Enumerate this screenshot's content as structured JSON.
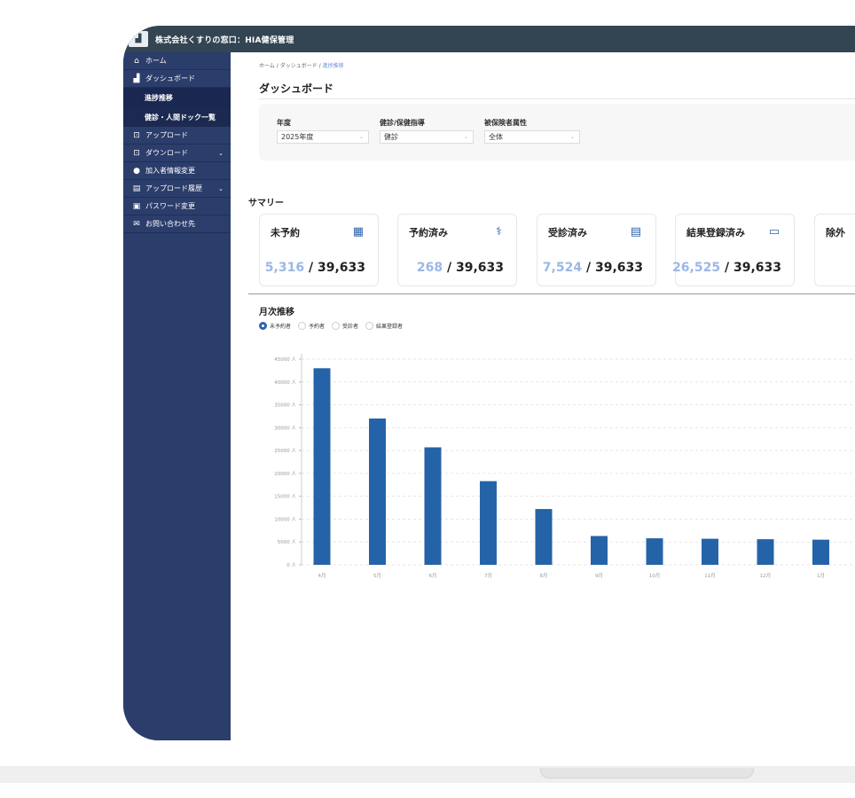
{
  "app": {
    "title": "株式会社くすりの窓口：HIA健保管理",
    "logo_icon": "building-logo-icon"
  },
  "sidebar": {
    "items": [
      {
        "label": "ホーム",
        "icon": "home-icon"
      },
      {
        "label": "ダッシュボード",
        "icon": "chart-icon",
        "sub": [
          "進捗推移",
          "健診・人間ドック一覧"
        ]
      },
      {
        "label": "アップロード",
        "icon": "upload-icon"
      },
      {
        "label": "ダウンロード",
        "icon": "download-icon",
        "chevron": true
      },
      {
        "label": "加入者情報変更",
        "icon": "user-icon"
      },
      {
        "label": "アップロード履歴",
        "icon": "history-icon",
        "chevron": true
      },
      {
        "label": "パスワード変更",
        "icon": "lock-icon"
      },
      {
        "label": "お問い合わせ先",
        "icon": "mail-icon"
      }
    ]
  },
  "breadcrumb": {
    "home": "ホーム",
    "sep": "/",
    "dashboard": "ダッシュボード",
    "current": "進捗推移"
  },
  "page_title": "ダッシュボード",
  "filters": {
    "year": {
      "label": "年度",
      "value": "2025年度"
    },
    "type": {
      "label": "健診/保健指導",
      "value": "健診"
    },
    "attr": {
      "label": "被保険者属性",
      "value": "全体"
    }
  },
  "summary": {
    "title": "サマリー",
    "total": "39,633",
    "cards": [
      {
        "label": "未予約",
        "value": "5,316",
        "icon": "calendar-icon"
      },
      {
        "label": "予約済み",
        "value": "268",
        "icon": "stethoscope-icon"
      },
      {
        "label": "受診済み",
        "value": "7,524",
        "icon": "clipboard-icon"
      },
      {
        "label": "結果登録済み",
        "value": "26,525",
        "icon": "message-icon"
      },
      {
        "label": "除外",
        "value": "",
        "icon": ""
      }
    ]
  },
  "monthly": {
    "title": "月次推移",
    "radios": [
      {
        "label": "未予約者",
        "checked": true
      },
      {
        "label": "予約者",
        "checked": false
      },
      {
        "label": "受診者",
        "checked": false
      },
      {
        "label": "結果登録者",
        "checked": false
      }
    ]
  },
  "colors": {
    "bar": "#2563a8",
    "accent": "#2e63ad"
  },
  "chart_data": {
    "type": "bar",
    "categories": [
      "4月",
      "5月",
      "6月",
      "7月",
      "8月",
      "9月",
      "10月",
      "11月",
      "12月",
      "1月"
    ],
    "values": [
      43000,
      32000,
      25700,
      18300,
      12200,
      6300,
      5800,
      5700,
      5600,
      5500
    ],
    "y_ticks": [
      "0 人",
      "5000 人",
      "10000 人",
      "15000 人",
      "20000 人",
      "25000 人",
      "30000 人",
      "35000 人",
      "40000 人",
      "45000 人"
    ],
    "ylim": [
      0,
      45000
    ],
    "grid": true
  }
}
